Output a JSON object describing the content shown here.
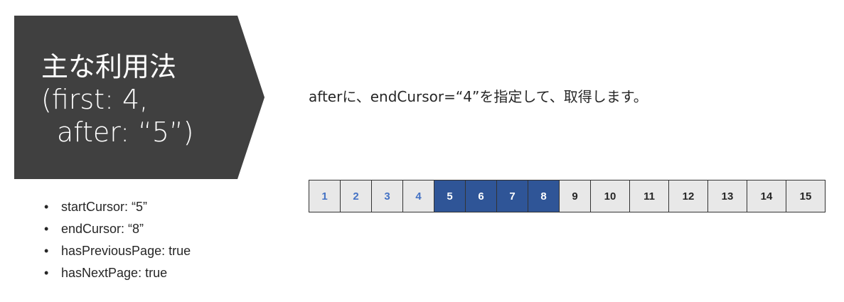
{
  "title": {
    "line1": "主な利用法",
    "line2": "(first: 4,",
    "line3": "after: “5”)"
  },
  "bullets": [
    "startCursor: “5”",
    "endCursor: “8”",
    "hasPreviousPage: true",
    "hasNextPage: true"
  ],
  "bullet_symbol": "•",
  "description": "afterに、endCursor=“4”を指定して、取得します。",
  "cells": [
    {
      "label": "1",
      "state": "before"
    },
    {
      "label": "2",
      "state": "before"
    },
    {
      "label": "3",
      "state": "before"
    },
    {
      "label": "4",
      "state": "before"
    },
    {
      "label": "5",
      "state": "selected"
    },
    {
      "label": "6",
      "state": "selected"
    },
    {
      "label": "7",
      "state": "selected"
    },
    {
      "label": "8",
      "state": "selected"
    },
    {
      "label": "9",
      "state": "after"
    },
    {
      "label": "10",
      "state": "after"
    },
    {
      "label": "11",
      "state": "after"
    },
    {
      "label": "12",
      "state": "after"
    },
    {
      "label": "13",
      "state": "after"
    },
    {
      "label": "14",
      "state": "after"
    },
    {
      "label": "15",
      "state": "after"
    }
  ],
  "colors": {
    "title_bg": "#404040",
    "selected_bg": "#2f5597",
    "before_text": "#4472c4",
    "cell_bg": "#e8e8e8"
  }
}
